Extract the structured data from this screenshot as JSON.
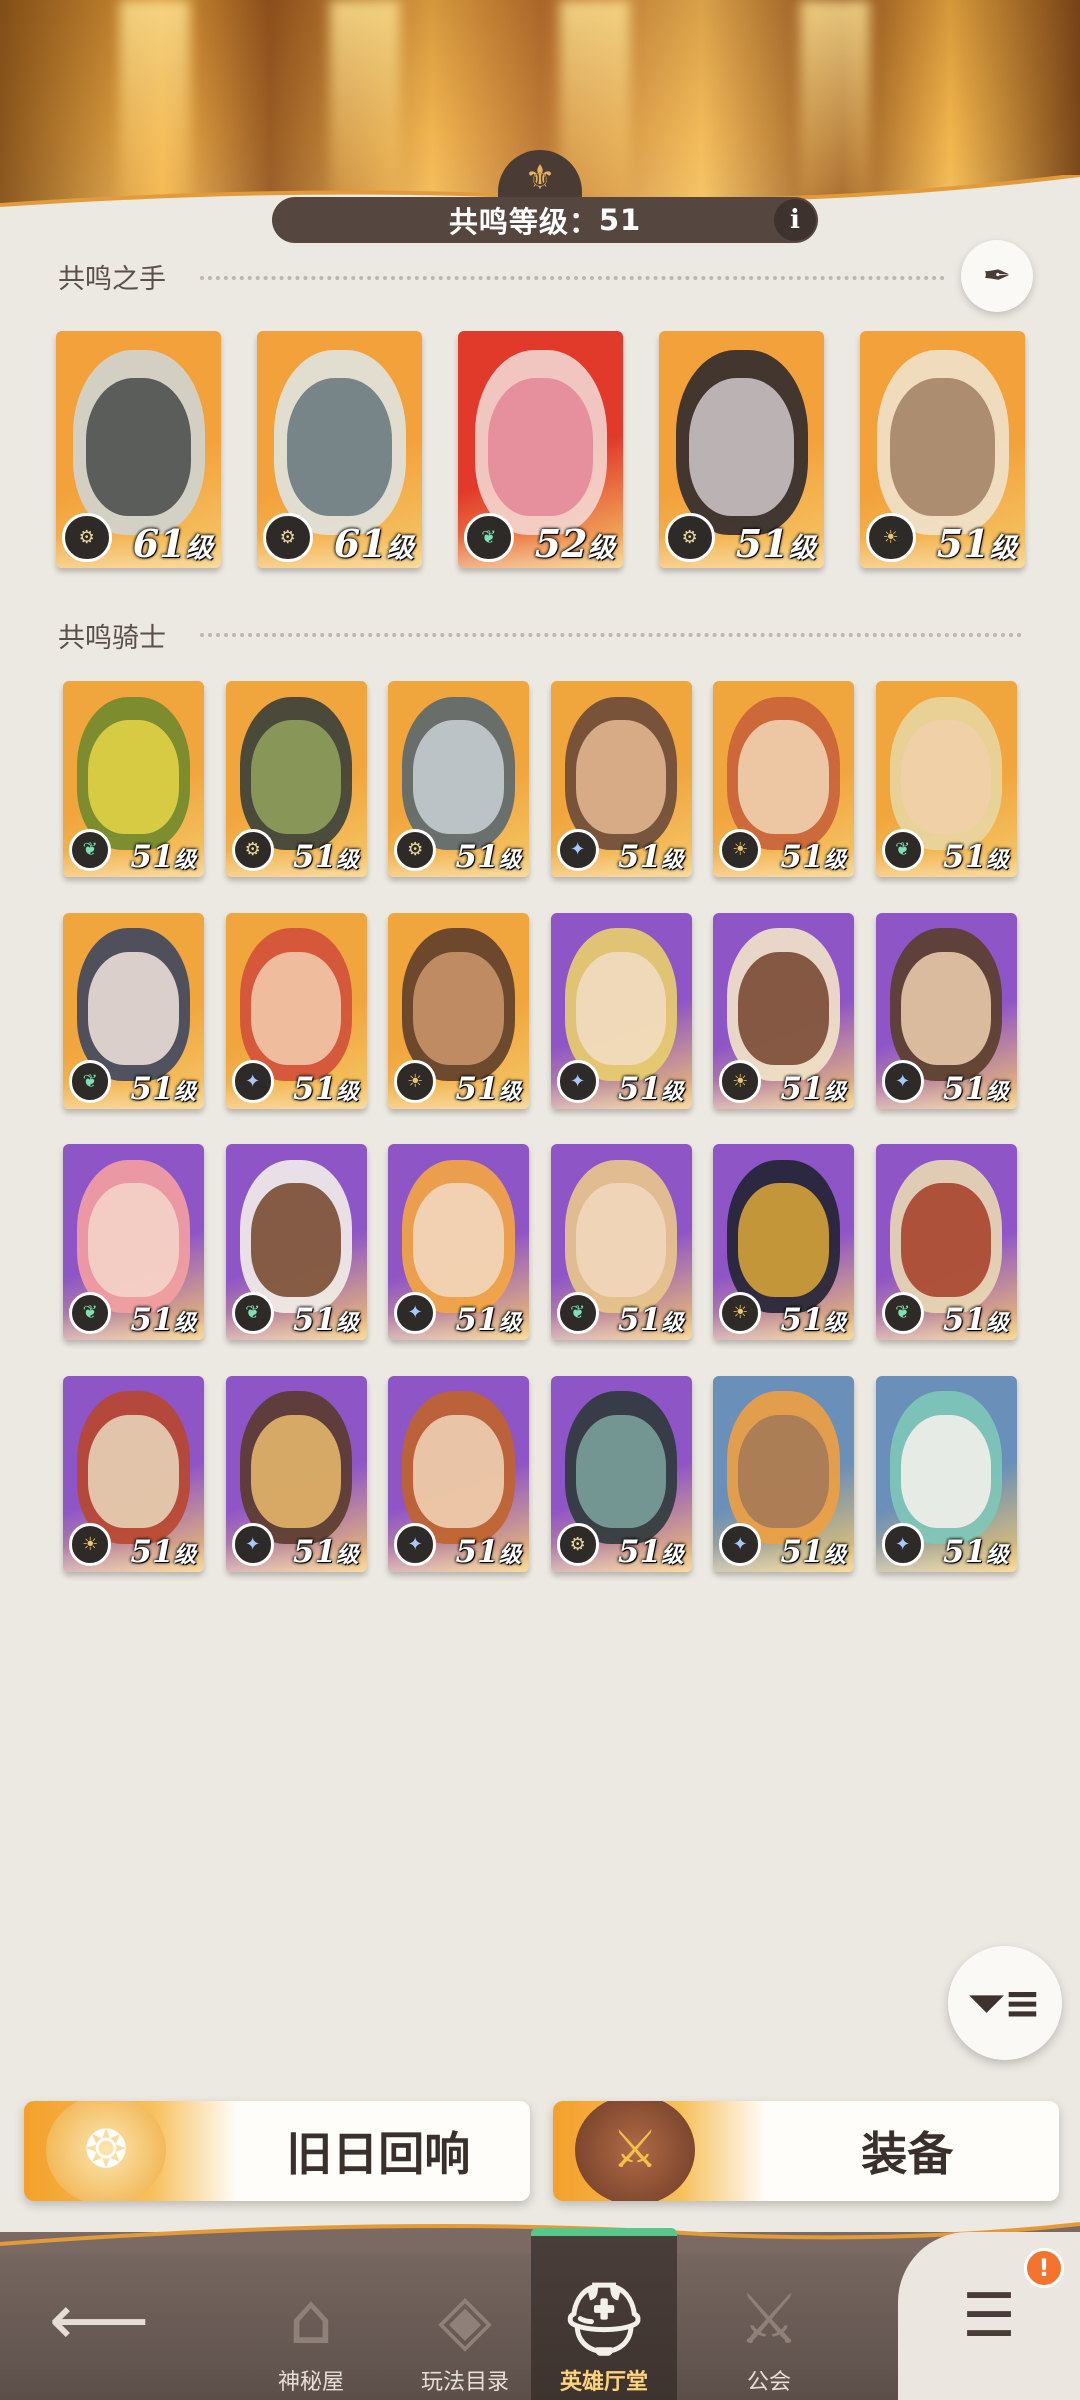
{
  "header": {
    "resonance_label": "共鸣等级：",
    "resonance_value": "51",
    "info_icon": "i"
  },
  "sections": {
    "hand_title": "共鸣之手",
    "knight_title": "共鸣骑士"
  },
  "level_suffix": "级",
  "hand_heroes": [
    {
      "level": "61",
      "faction": "tech-gear",
      "colors": [
        "#f3a13a",
        "#cfd4d2",
        "#4e5050"
      ]
    },
    {
      "level": "61",
      "faction": "tech-gear",
      "colors": [
        "#f3a13a",
        "#dfe3e0",
        "#6b7a80"
      ]
    },
    {
      "level": "52",
      "faction": "nature-leaf",
      "colors": [
        "#e23a2a",
        "#f4d6d0",
        "#e48a9a"
      ]
    },
    {
      "level": "51",
      "faction": "tech-gear",
      "colors": [
        "#f3a13a",
        "#2f2a2e",
        "#c9c0c2"
      ]
    },
    {
      "level": "51",
      "faction": "radiant-sun",
      "colors": [
        "#f3a13a",
        "#efe2cc",
        "#a58466"
      ]
    }
  ],
  "knight_heroes": [
    {
      "level": "51",
      "faction": "nature-leaf",
      "colors": [
        "#f1a53d",
        "#6f8a2c",
        "#e1d147"
      ]
    },
    {
      "level": "51",
      "faction": "tech-gear",
      "colors": [
        "#f1a53d",
        "#39403a",
        "#8fa05c"
      ]
    },
    {
      "level": "51",
      "faction": "tech-gear",
      "colors": [
        "#f1a53d",
        "#5a6870",
        "#c4ccd0"
      ]
    },
    {
      "level": "51",
      "faction": "star-compass",
      "colors": [
        "#f1a53d",
        "#6a4a3a",
        "#e0b58f"
      ]
    },
    {
      "level": "51",
      "faction": "radiant-sun",
      "colors": [
        "#f1a53d",
        "#c9623a",
        "#f1d2b0"
      ]
    },
    {
      "level": "51",
      "faction": "nature-leaf",
      "colors": [
        "#f1a53d",
        "#e8d6a0",
        "#f0cfa8"
      ]
    },
    {
      "level": "51",
      "faction": "nature-leaf",
      "colors": [
        "#f1a53d",
        "#3e4760",
        "#e9ddd6"
      ]
    },
    {
      "level": "51",
      "faction": "star-compass",
      "colors": [
        "#f1a53d",
        "#d2503a",
        "#f2c8a8"
      ]
    },
    {
      "level": "51",
      "faction": "radiant-sun",
      "colors": [
        "#f1a53d",
        "#5e3e2a",
        "#c79268"
      ]
    },
    {
      "level": "51",
      "faction": "star-compass",
      "colors": [
        "#8e55c7",
        "#e9cf6b",
        "#f2dcc0"
      ]
    },
    {
      "level": "51",
      "faction": "radiant-sun",
      "colors": [
        "#8e55c7",
        "#f2e6c8",
        "#7a4a34"
      ]
    },
    {
      "level": "51",
      "faction": "star-compass",
      "colors": [
        "#8e55c7",
        "#5a3e2a",
        "#e8c9aa"
      ]
    },
    {
      "level": "51",
      "faction": "nature-leaf",
      "colors": [
        "#8e55c7",
        "#f4a0a0",
        "#f4d3c8"
      ]
    },
    {
      "level": "51",
      "faction": "nature-leaf",
      "colors": [
        "#8e55c7",
        "#f2efe9",
        "#7b4d33"
      ]
    },
    {
      "level": "51",
      "faction": "star-compass",
      "colors": [
        "#8e55c7",
        "#f5a640",
        "#f2d6bc"
      ]
    },
    {
      "level": "51",
      "faction": "nature-leaf",
      "colors": [
        "#8e55c7",
        "#e9c88a",
        "#f2d6bc"
      ]
    },
    {
      "level": "51",
      "faction": "radiant-sun",
      "colors": [
        "#8e55c7",
        "#222433",
        "#d5a23a"
      ]
    },
    {
      "level": "51",
      "faction": "nature-leaf",
      "colors": [
        "#8e55c7",
        "#e9d9b2",
        "#a8442e"
      ]
    },
    {
      "level": "51",
      "faction": "radiant-sun",
      "colors": [
        "#8e55c7",
        "#b9472e",
        "#e7d2b6"
      ]
    },
    {
      "level": "51",
      "faction": "star-compass",
      "colors": [
        "#8e55c7",
        "#5a3b2c",
        "#e4b56a"
      ]
    },
    {
      "level": "51",
      "faction": "star-compass",
      "colors": [
        "#8e55c7",
        "#c0642a",
        "#efcfb2"
      ]
    },
    {
      "level": "51",
      "faction": "tech-gear",
      "colors": [
        "#8e55c7",
        "#2e3a3a",
        "#7aa09a"
      ]
    },
    {
      "level": "51",
      "faction": "star-compass",
      "colors": [
        "#6a8fb8",
        "#f0a040",
        "#a67a58"
      ]
    },
    {
      "level": "51",
      "faction": "star-compass",
      "colors": [
        "#6a8fb8",
        "#7ec8b8",
        "#f3efea"
      ]
    }
  ],
  "features": {
    "echo_label": "旧日回响",
    "gear_label": "装备"
  },
  "nav": {
    "items": [
      {
        "label": "神秘屋",
        "icon": "house-icon"
      },
      {
        "label": "玩法目录",
        "icon": "diamond-icon"
      },
      {
        "label": "英雄厅堂",
        "icon": "helmet-icon"
      },
      {
        "label": "公会",
        "icon": "swords-icon"
      }
    ],
    "active_index": 2
  },
  "menu_alert": "!"
}
